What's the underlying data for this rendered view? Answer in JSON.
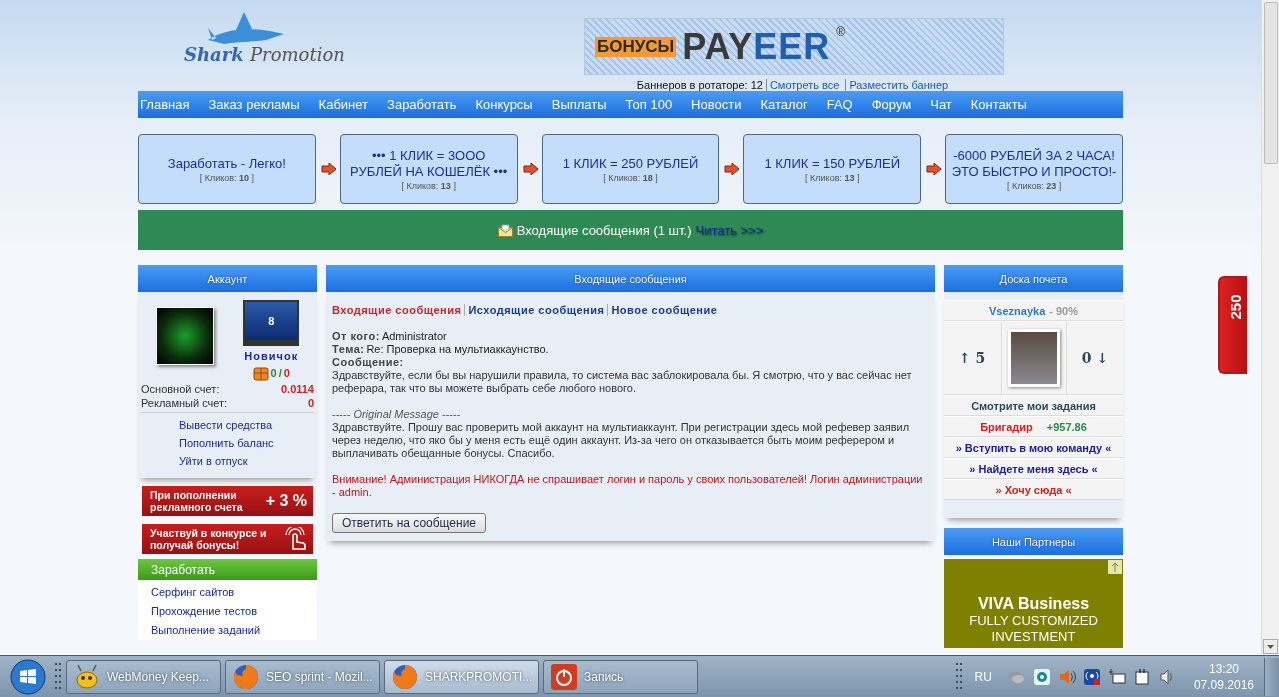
{
  "header": {
    "logo": {
      "word_1": "Shark",
      "word_2": "Promotion"
    },
    "banner": {
      "word_1": "БОНУСЫ",
      "word_2": "PAY",
      "word_3": "EER",
      "mark": "®"
    },
    "rotator": {
      "label": "Баннеров в ротаторе: 12",
      "links": [
        "Смотреть все",
        "Разместить баннер"
      ]
    }
  },
  "nav": [
    "Главная",
    "Заказ рекламы",
    "Кабинет",
    "Заработать",
    "Конкурсы",
    "Выплаты",
    "Топ 100",
    "Новости",
    "Каталог",
    "FAQ",
    "Форум",
    "Чат",
    "Контакты"
  ],
  "ads": [
    {
      "title": "Заработать - Легко!",
      "clicks": "[ Кликов: **10** ]"
    },
    {
      "title": "••• 1 КЛИК = 3ООО РУБЛЕЙ НА КОШЕЛЁК •••",
      "clicks": "[ Кликов: **13** ]"
    },
    {
      "title": "1 КЛИК = 250 РУБЛЕЙ",
      "clicks": "[ Кликов: **18** ]"
    },
    {
      "title": "1 КЛИК = 150 РУБЛЕЙ",
      "clicks": "[ Кликов: **13** ]"
    },
    {
      "title": "-6000 РУБЛЕЙ ЗА 2 ЧАСА!ЭТО БЫСТРО И ПРОСТО!-",
      "clicks": "[ Кликов: **23** ]"
    }
  ],
  "notice": {
    "text": "Входящие сообщения (1 шт.)",
    "link": "Читать >>>"
  },
  "account": {
    "title": "Аккаунт",
    "level": "8",
    "rank": "Новичок",
    "earned": "0",
    "separator": "/",
    "spent": "0",
    "balances": [
      {
        "label": "Основной счет:",
        "value": "0.0114"
      },
      {
        "label": "Рекламный счет:",
        "value": "0"
      }
    ],
    "links": [
      "Вывести средства",
      "Пополнить баланс",
      "Уйти в отпуск"
    ]
  },
  "promos": [
    {
      "kind": "percent",
      "text": "При пополнении рекламного счета",
      "extra": "+ 3 %"
    },
    {
      "kind": "hand",
      "text": "Участвуй в конкурсе и получай бонусы!"
    }
  ],
  "earn_menu": {
    "title": "Заработать",
    "items": [
      "Серфинг сайтов",
      "Прохождение тестов",
      "Выполнение заданий"
    ]
  },
  "messages": {
    "title": "Входящие сообщения",
    "tabs": [
      {
        "label": "Входящие сообщения",
        "selected": true
      },
      {
        "label": "Исходящие сообщения",
        "selected": false
      },
      {
        "label": "Новое сообщение",
        "selected": false
      }
    ],
    "fields": [
      {
        "label": "От кого:",
        "value": "Administrator"
      },
      {
        "label": "Тема:",
        "value": "Re: Проверка на мультиаккаунство."
      },
      {
        "label": "Сообщение:"
      }
    ],
    "body": "Здравствуйте, если бы вы нарушили правила, то система вас заблокировала бы. Я смотрю, что у вас сейчас нет реферара, так что вы можете выбрать себе любого нового.",
    "quote_header": "----- *Original Message* -----",
    "quote": "Здравствуйте. Прошу вас проверить мой аккаунт на мультиаккаунт. При регистрации здесь мой рефевер заявил через неделю, что яко бы у меня есть ещё один аккаунт. Из-за чего он отказывается быть моим реферером и выплачивать обещанные бонусы. Спасибо.",
    "warning": "Внимание! Администрация НИКОГДА не спрашивает логин и пароль у своих пользователей! Логин администрации - admin.",
    "reply_button": "Ответить на сообщение"
  },
  "honor_board": {
    "title": "Доска почета",
    "user": "Vseznayka",
    "percent": "- 90%",
    "votes_up": "↑ 5",
    "votes_down": "0 ↓",
    "tasks_link": "Смотрите мои задания",
    "rank": "Бригадир",
    "score": "+957.86",
    "links": [
      {
        "text": "» Вступить в мою команду «",
        "color": "#1a1aa6"
      },
      {
        "text": "» Найдете меня здесь «",
        "color": "#1a1aa6"
      },
      {
        "text": "» Хочу сюда «",
        "color": "#d42020"
      }
    ]
  },
  "partners": {
    "title": "Наши Партнеры",
    "ad_title": "VIVA Business",
    "ad_text": "FULLY CUSTOMIZED INVESTMENT"
  },
  "side_badge": "250",
  "taskbar": {
    "tasks": [
      {
        "kind": "webmoney",
        "label": "WebMoney Keep...",
        "selected": false
      },
      {
        "kind": "browser",
        "label": "SEO sprint - Mozil...",
        "selected": false
      },
      {
        "kind": "browser",
        "label": "SHARKPROMOTI...",
        "selected": true
      },
      {
        "kind": "record",
        "label": "Запись",
        "selected": false
      }
    ],
    "language": "RU",
    "time": "13:20",
    "date": "07.09.2016"
  }
}
